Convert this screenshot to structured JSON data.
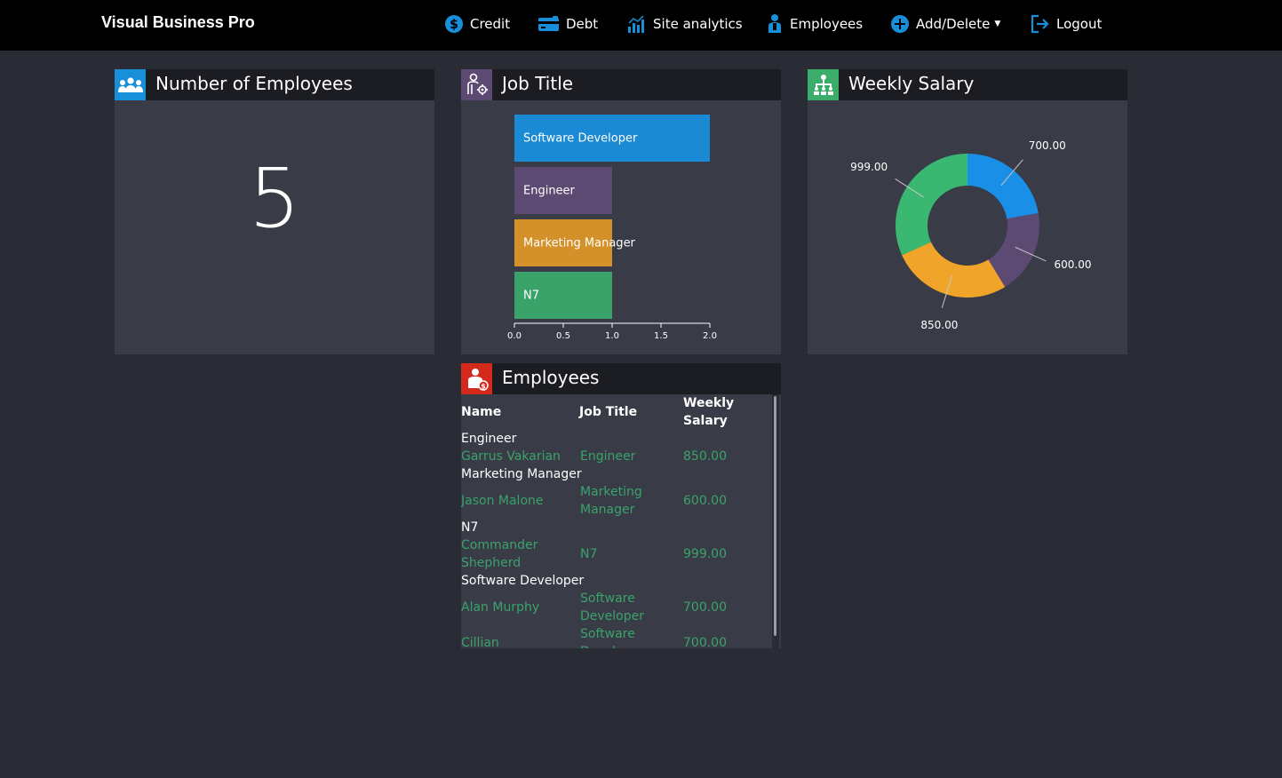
{
  "navbar": {
    "brand": "Visual Business Pro",
    "items": [
      {
        "label": "Credit",
        "icon": "dollar-circle-icon"
      },
      {
        "label": "Debt",
        "icon": "credit-card-icon"
      },
      {
        "label": "Site analytics",
        "icon": "bar-chart-icon"
      },
      {
        "label": "Employees",
        "icon": "person-icon"
      },
      {
        "label": "Add/Delete",
        "icon": "plus-circle-icon",
        "caret": "▼"
      },
      {
        "label": "Logout",
        "icon": "logout-icon"
      }
    ],
    "icon_color": "#1a8fd9"
  },
  "employees_count_panel": {
    "title": "Number of Employees",
    "value": "5",
    "icon": "people-group-icon",
    "icon_bg": "#1a8fd9"
  },
  "job_title_panel": {
    "title": "Job Title",
    "icon": "person-gear-icon",
    "icon_bg": "#5d4a73"
  },
  "weekly_salary_panel": {
    "title": "Weekly Salary",
    "icon": "org-chart-icon",
    "icon_bg": "#3aad6a"
  },
  "employees_table_panel": {
    "title": "Employees",
    "icon": "person-money-icon",
    "icon_bg": "#d42a1c",
    "headers": {
      "name": "Name",
      "job_title": "Job Title",
      "weekly_salary_1": "Weekly",
      "weekly_salary_2": "Salary"
    },
    "groups": [
      {
        "label": "Engineer",
        "rows": [
          {
            "name": [
              "Garrus Vakarian"
            ],
            "job": [
              "Engineer"
            ],
            "salary": "850.00"
          }
        ]
      },
      {
        "label": "Marketing Manager",
        "rows": [
          {
            "name": [
              "Jason Malone"
            ],
            "job": [
              "Marketing",
              "Manager"
            ],
            "salary": "600.00"
          }
        ]
      },
      {
        "label": "N7",
        "rows": [
          {
            "name": [
              "Commander",
              "Shepherd"
            ],
            "job": [
              "N7"
            ],
            "salary": "999.00"
          }
        ]
      },
      {
        "label": "Software Developer",
        "rows": [
          {
            "name": [
              "Alan Murphy"
            ],
            "job": [
              "Software",
              "Developer"
            ],
            "salary": "700.00"
          },
          {
            "name": [
              "Cillian"
            ],
            "job": [
              "Software",
              "Developer"
            ],
            "salary": "700.00"
          }
        ]
      }
    ]
  },
  "chart_data": [
    {
      "type": "bar",
      "orientation": "horizontal",
      "categories": [
        "Software Developer",
        "Engineer",
        "Marketing Manager",
        "N7"
      ],
      "values": [
        2,
        1,
        1,
        1
      ],
      "colors": [
        "#1a8ad4",
        "#5d4a73",
        "#d4912a",
        "#3aa36a"
      ],
      "xlim": [
        0,
        2
      ],
      "xticks": [
        "0.0",
        "0.5",
        "1.0",
        "1.5",
        "2.0"
      ],
      "grid": false
    },
    {
      "type": "pie",
      "donut": true,
      "values": [
        700,
        600,
        850,
        999
      ],
      "labels": [
        "700.00",
        "600.00",
        "850.00",
        "999.00"
      ],
      "colors": [
        "#1a8fe8",
        "#5d4a73",
        "#f0a52a",
        "#3ab872"
      ]
    }
  ]
}
